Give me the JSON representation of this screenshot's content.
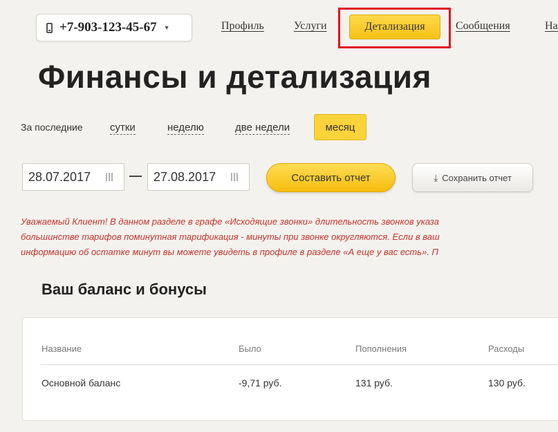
{
  "phone_selector": {
    "number": "+7-903-123-45-67",
    "icon": "phone-icon"
  },
  "nav": {
    "items": [
      "Профиль",
      "Услуги",
      "Детализация",
      "Сообщения",
      "На"
    ],
    "active": "Детализация"
  },
  "page_title": "Финансы и детализация",
  "period": {
    "label": "За последние",
    "options": [
      "сутки",
      "неделю",
      "две недели",
      "месяц"
    ],
    "selected": "месяц"
  },
  "dates": {
    "from": "28.07.2017",
    "to": "27.08.2017"
  },
  "buttons": {
    "make_report": "Составить отчет",
    "save_report": "Сохранить отчет"
  },
  "notice_lines": [
    "Уважаемый Клиент! В данном разделе в графе «Исходящие звонки» длительность звонков указа",
    "большинстве тарифов поминутная тарификация - минуты при звонке округляются. Если в ваш",
    "информацию об остатке минут вы можете увидеть в профиле в разделе «А еще у вас есть». П"
  ],
  "balance": {
    "title": "Ваш баланс и бонусы",
    "columns": [
      "Название",
      "Было",
      "Пополнения",
      "Расходы"
    ],
    "rows": [
      {
        "name": "Основной баланс",
        "was": "-9,71 руб.",
        "topups": "131 руб.",
        "expenses": "130 руб."
      }
    ]
  },
  "colors": {
    "accent_yellow": "#fbd33a",
    "highlight_red": "#e0141e",
    "notice_red": "#c4332b"
  }
}
